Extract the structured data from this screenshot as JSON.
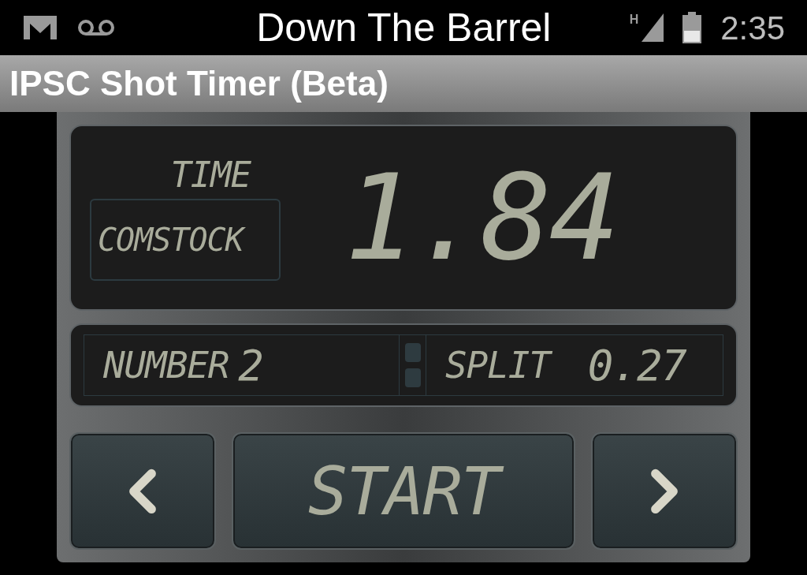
{
  "status_bar": {
    "title": "Down The Barrel",
    "time": "2:35",
    "network": "H"
  },
  "action_bar": {
    "title": "IPSC Shot Timer (Beta)"
  },
  "display": {
    "time_label": "TIME",
    "string_name": "COMSTOCK",
    "time": "1.84",
    "number_label": "NUMBER",
    "number": "2",
    "split_label": "SPLIT",
    "split": "0.27"
  },
  "buttons": [
    {
      "kind": "prev"
    },
    {
      "kind": "start",
      "label": "START"
    },
    {
      "kind": "next"
    }
  ]
}
